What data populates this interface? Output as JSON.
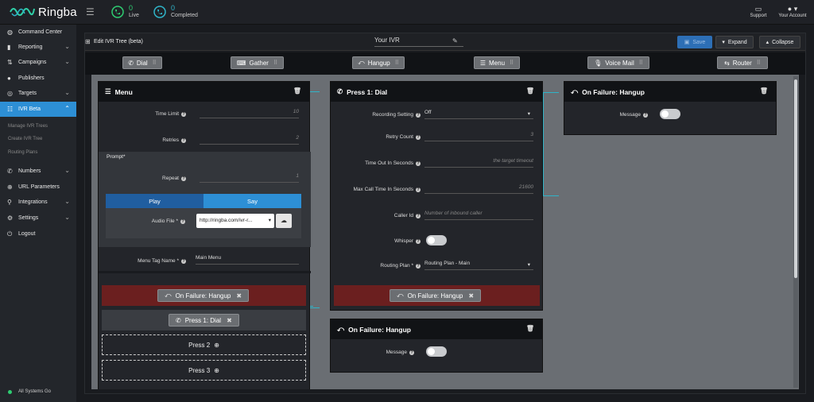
{
  "app": {
    "name": "Ringba"
  },
  "topbar": {
    "live": {
      "count": "0",
      "label": "Live"
    },
    "completed": {
      "count": "0",
      "label": "Completed"
    },
    "support": "Support",
    "account": "Your Account"
  },
  "sidebar": {
    "items": [
      {
        "label": "Command Center",
        "icon": "dashboard-icon"
      },
      {
        "label": "Reporting",
        "icon": "chart-icon"
      },
      {
        "label": "Campaigns",
        "icon": "campaign-icon"
      },
      {
        "label": "Publishers",
        "icon": "users-icon"
      },
      {
        "label": "Targets",
        "icon": "target-icon"
      },
      {
        "label": "IVR Beta",
        "icon": "ivr-icon"
      },
      {
        "label": "Numbers",
        "icon": "phone-icon"
      },
      {
        "label": "URL Parameters",
        "icon": "link-icon"
      },
      {
        "label": "Integrations",
        "icon": "plug-icon"
      },
      {
        "label": "Settings",
        "icon": "gear-icon"
      },
      {
        "label": "Logout",
        "icon": "power-icon"
      }
    ],
    "subitems": [
      "Manage IVR Trees",
      "Create IVR Tree",
      "Routing Plans"
    ],
    "status": "All Systems Go"
  },
  "editor": {
    "title": "Edit IVR Tree (beta)",
    "tree_name": "Your IVR",
    "save": "Save",
    "expand": "Expand",
    "collapse": "Collapse",
    "tools": [
      "Dial",
      "Gather",
      "Hangup",
      "Menu",
      "Voice Mail",
      "Router"
    ]
  },
  "menu_card": {
    "title": "Menu",
    "time_limit_label": "Time Limit",
    "time_limit": "10",
    "retries_label": "Retries",
    "retries": "2",
    "prompt_label": "Prompt",
    "repeat_label": "Repeat",
    "repeat": "1",
    "play_tab": "Play",
    "say_tab": "Say",
    "audio_file_label": "Audio File",
    "audio_file": "http://ringba.com/ivr-r...",
    "tag_label": "Menu Tag Name",
    "tag_value": "Main Menu",
    "failure_chip": "On Failure: Hangup",
    "press1_chip": "Press 1: Dial",
    "press2": "Press 2",
    "press3": "Press 3"
  },
  "dial_card": {
    "title": "Press 1: Dial",
    "recording_label": "Recording Setting",
    "recording": "Off",
    "retry_label": "Retry Count",
    "retry": "3",
    "timeout_label": "Time Out In Seconds",
    "timeout_ph": "the target timeout",
    "maxcall_label": "Max Call Time In Seconds",
    "maxcall": "21600",
    "callerid_label": "Caller Id",
    "callerid_ph": "Number of inbound caller",
    "whisper_label": "Whisper",
    "routing_label": "Routing Plan",
    "routing": "Routing Plan - Main",
    "failure_chip": "On Failure: Hangup"
  },
  "hangup_card_1": {
    "title": "On Failure: Hangup",
    "message_label": "Message"
  },
  "hangup_card_2": {
    "title": "On Failure: Hangup",
    "message_label": "Message"
  },
  "colors": {
    "accent": "#2d8fd5",
    "live": "#2ecc71",
    "completed": "#2fb4c8",
    "failure": "#6b1f1f",
    "connector": "#2fb4c8"
  }
}
